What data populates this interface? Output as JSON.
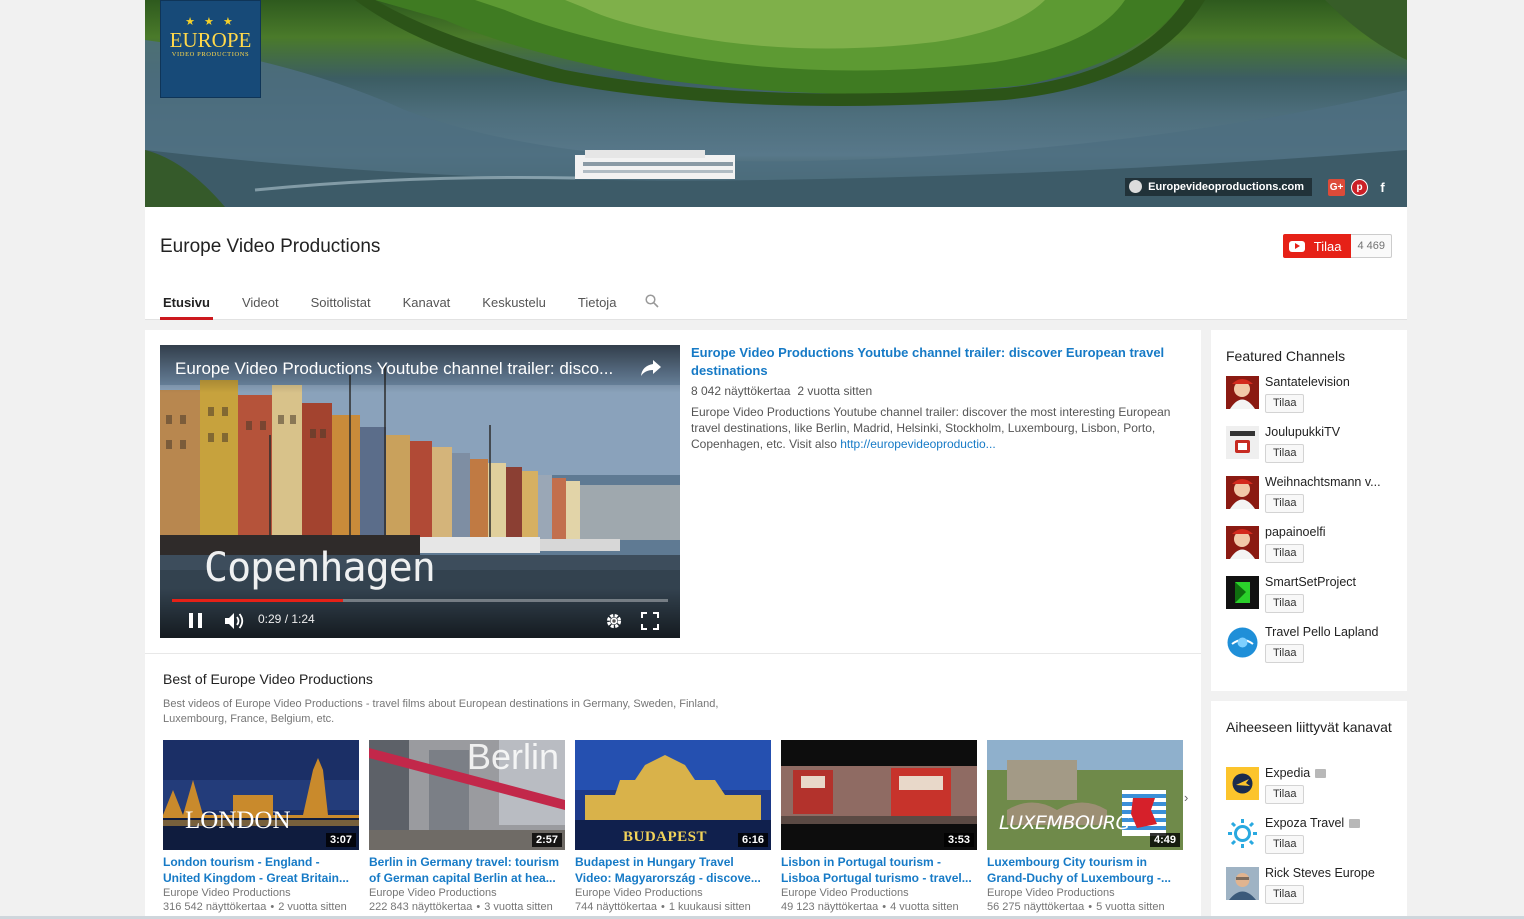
{
  "banner": {
    "logo_title": "EUROPE",
    "logo_subtitle": "VIDEO PRODUCTIONS",
    "logo_stars": "★ ★ ★",
    "website_link": "Europevideoproductions.com",
    "social": {
      "gplus": "G+",
      "pinterest": "p",
      "facebook": "f"
    }
  },
  "header": {
    "channel_name": "Europe Video Productions",
    "subscribe_label": "Tilaa",
    "subscriber_count": "4 469",
    "tabs": [
      {
        "label": "Etusivu",
        "active": true
      },
      {
        "label": "Videot",
        "active": false
      },
      {
        "label": "Soittolistat",
        "active": false
      },
      {
        "label": "Kanavat",
        "active": false
      },
      {
        "label": "Keskustelu",
        "active": false
      },
      {
        "label": "Tietoja",
        "active": false
      }
    ]
  },
  "featured": {
    "player_title": "Europe Video Productions Youtube channel trailer: disco...",
    "overlay_city": "Copenhagen",
    "time": "0:29 / 1:24",
    "progress_fraction": 0.345,
    "title": "Europe Video Productions Youtube channel trailer: discover European travel destinations",
    "views": "8 042 näyttökertaa",
    "age": "2 vuotta sitten",
    "description": "Europe Video Productions Youtube channel trailer: discover the most interesting European travel destinations, like Berlin, Madrid, Helsinki, Stockholm, Luxembourg, Lisbon, Porto, Copenhagen, etc. Visit also ",
    "link": "http://europevideoproductio..."
  },
  "shelf": {
    "title": "Best of Europe Video Productions",
    "description": "Best videos of Europe Video Productions - travel films about European destinations in Germany, Sweden, Finland, Luxembourg, France, Belgium, etc.",
    "next_arrow": "›",
    "videos": [
      {
        "thumb_word": "LONDON",
        "duration": "3:07",
        "title": "London tourism - England - United Kingdom - Great Britain...",
        "channel": "Europe Video Productions",
        "views": "316 542 näyttökertaa",
        "age": "2 vuotta sitten"
      },
      {
        "thumb_word": "Berlin",
        "duration": "2:57",
        "title": "Berlin in Germany travel: tourism of German capital Berlin at hea...",
        "channel": "Europe Video Productions",
        "views": "222 843 näyttökertaa",
        "age": "3 vuotta sitten"
      },
      {
        "thumb_word": "BUDAPEST",
        "duration": "6:16",
        "title": "Budapest in Hungary Travel Video: Magyarország - discove...",
        "channel": "Europe Video Productions",
        "views": "744 näyttökertaa",
        "age": "1 kuukausi sitten"
      },
      {
        "thumb_word": "",
        "duration": "3:53",
        "title": "Lisbon in Portugal tourism - Lisboa Portugal turismo - travel...",
        "channel": "Europe Video Productions",
        "views": "49 123 näyttökertaa",
        "age": "4 vuotta sitten"
      },
      {
        "thumb_word": "LUXEMBOURG",
        "duration": "4:49",
        "title": "Luxembourg City tourism in Grand-Duchy of Luxembourg -...",
        "channel": "Europe Video Productions",
        "views": "56 275 näyttökertaa",
        "age": "5 vuotta sitten"
      }
    ]
  },
  "sidebar": {
    "featured_heading": "Featured Channels",
    "featured": [
      {
        "name": "Santatelevision",
        "subscribe": "Tilaa"
      },
      {
        "name": "JoulupukkiTV",
        "subscribe": "Tilaa"
      },
      {
        "name": "Weihnachtsmann v...",
        "subscribe": "Tilaa"
      },
      {
        "name": "papainoelfi",
        "subscribe": "Tilaa"
      },
      {
        "name": "SmartSetProject",
        "subscribe": "Tilaa"
      },
      {
        "name": "Travel Pello Lapland",
        "subscribe": "Tilaa"
      }
    ],
    "related_heading": "Aiheeseen liittyvät kanavat",
    "related": [
      {
        "name": "Expedia",
        "verified": true,
        "subscribe": "Tilaa"
      },
      {
        "name": "Expoza Travel",
        "verified": true,
        "subscribe": "Tilaa"
      },
      {
        "name": "Rick Steves Europe",
        "verified": false,
        "subscribe": "Tilaa"
      }
    ]
  },
  "colors": {
    "accent": "#cc181e",
    "link": "#167ac6",
    "subscribe": "#e62117"
  }
}
